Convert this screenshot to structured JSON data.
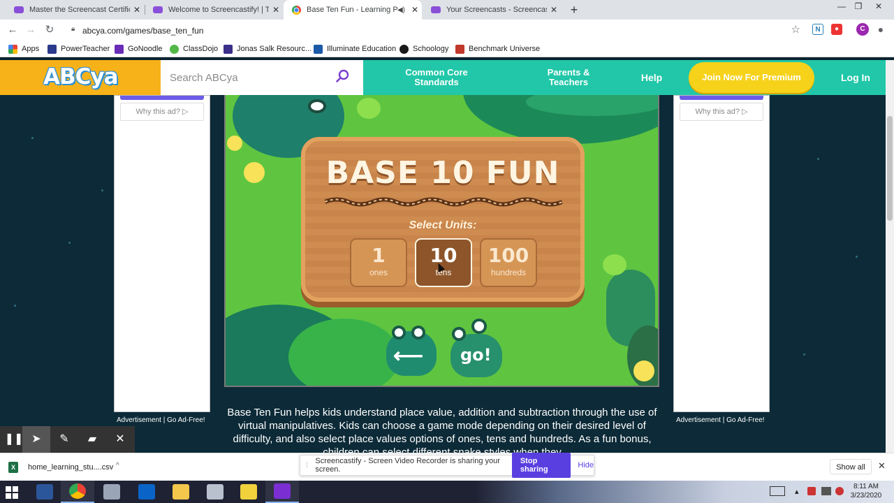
{
  "browser": {
    "tabs": [
      {
        "label": "Master the Screencast Certificati",
        "active": false
      },
      {
        "label": "Welcome to Screencastify! | The",
        "active": false
      },
      {
        "label": "Base Ten Fun - Learning Pla",
        "active": true
      },
      {
        "label": "Your Screencasts - Screencastify",
        "active": false
      }
    ],
    "url": "abcya.com/games/base_ten_fun",
    "bookmarks": [
      {
        "label": "Apps",
        "color": "#ea4335"
      },
      {
        "label": "PowerTeacher",
        "color": "#2b3a8c"
      },
      {
        "label": "GoNoodle",
        "color": "#6a2db8"
      },
      {
        "label": "ClassDojo",
        "color": "#52b848"
      },
      {
        "label": "Jonas Salk Resourc...",
        "color": "#3b2f8a"
      },
      {
        "label": "Illuminate Education",
        "color": "#1c5aa8"
      },
      {
        "label": "Schoology",
        "color": "#1a1a1a"
      },
      {
        "label": "Benchmark Universe",
        "color": "#c0392b"
      }
    ],
    "profile_initial": "C"
  },
  "site": {
    "logo": "ABCya",
    "search_placeholder": "Search ABCya",
    "nav": {
      "common_core": "Common Core Standards",
      "parents": "Parents & Teachers",
      "help": "Help",
      "premium": "Join Now For Premium",
      "login": "Log In"
    },
    "ads": {
      "why_left": "Why this ad? ▷",
      "why_right": "Why this ad? ▷",
      "caption_left": "Advertisement | Go Ad-Free!",
      "caption_right": "Advertisement | Go Ad-Free!"
    }
  },
  "game": {
    "title": "BASE 10 FUN",
    "select_label": "Select Units:",
    "units": [
      {
        "number": "1",
        "word": "ones",
        "selected": false
      },
      {
        "number": "10",
        "word": "tens",
        "selected": true
      },
      {
        "number": "100",
        "word": "hundreds",
        "selected": false
      }
    ],
    "go_label": "go!"
  },
  "description": "Base Ten Fun helps kids understand place value, addition and subtraction through the use of virtual manipulatives. Kids can choose a game mode depending on their desired level of difficulty, and also select place values options of ones, tens and hundreds. As a fun bonus, children can select different snake styles when they",
  "download_shelf": {
    "file": "home_learning_stu....csv",
    "share_message": "Screencastify - Screen Video Recorder is sharing your screen.",
    "stop_label": "Stop sharing",
    "hide_label": "Hide",
    "show_all": "Show all"
  },
  "taskbar": {
    "time": "8:11 AM",
    "date": "3/23/2020"
  }
}
